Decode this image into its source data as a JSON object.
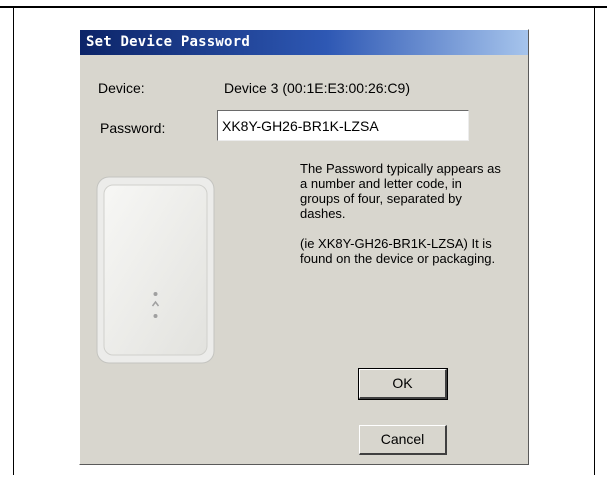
{
  "dialog": {
    "title": "Set Device Password",
    "device_label": "Device:",
    "device_value": "Device 3 (00:1E:E3:00:26:C9)",
    "password_label": "Password:",
    "password_value": "XK8Y-GH26-BR1K-LZSA",
    "help_paragraph_1": "The Password typically appears as a number and letter code, in groups of four, separated by dashes.",
    "help_paragraph_2": "(ie XK8Y-GH26-BR1K-LZSA) It is found on the device or packaging.",
    "ok_label": "OK",
    "cancel_label": "Cancel"
  },
  "colors": {
    "dialog_bg": "#d8d6ce",
    "titlebar_start": "#0c2468",
    "titlebar_end": "#a6c4ec"
  },
  "image": {
    "icon": "powerline-adapter-icon"
  }
}
